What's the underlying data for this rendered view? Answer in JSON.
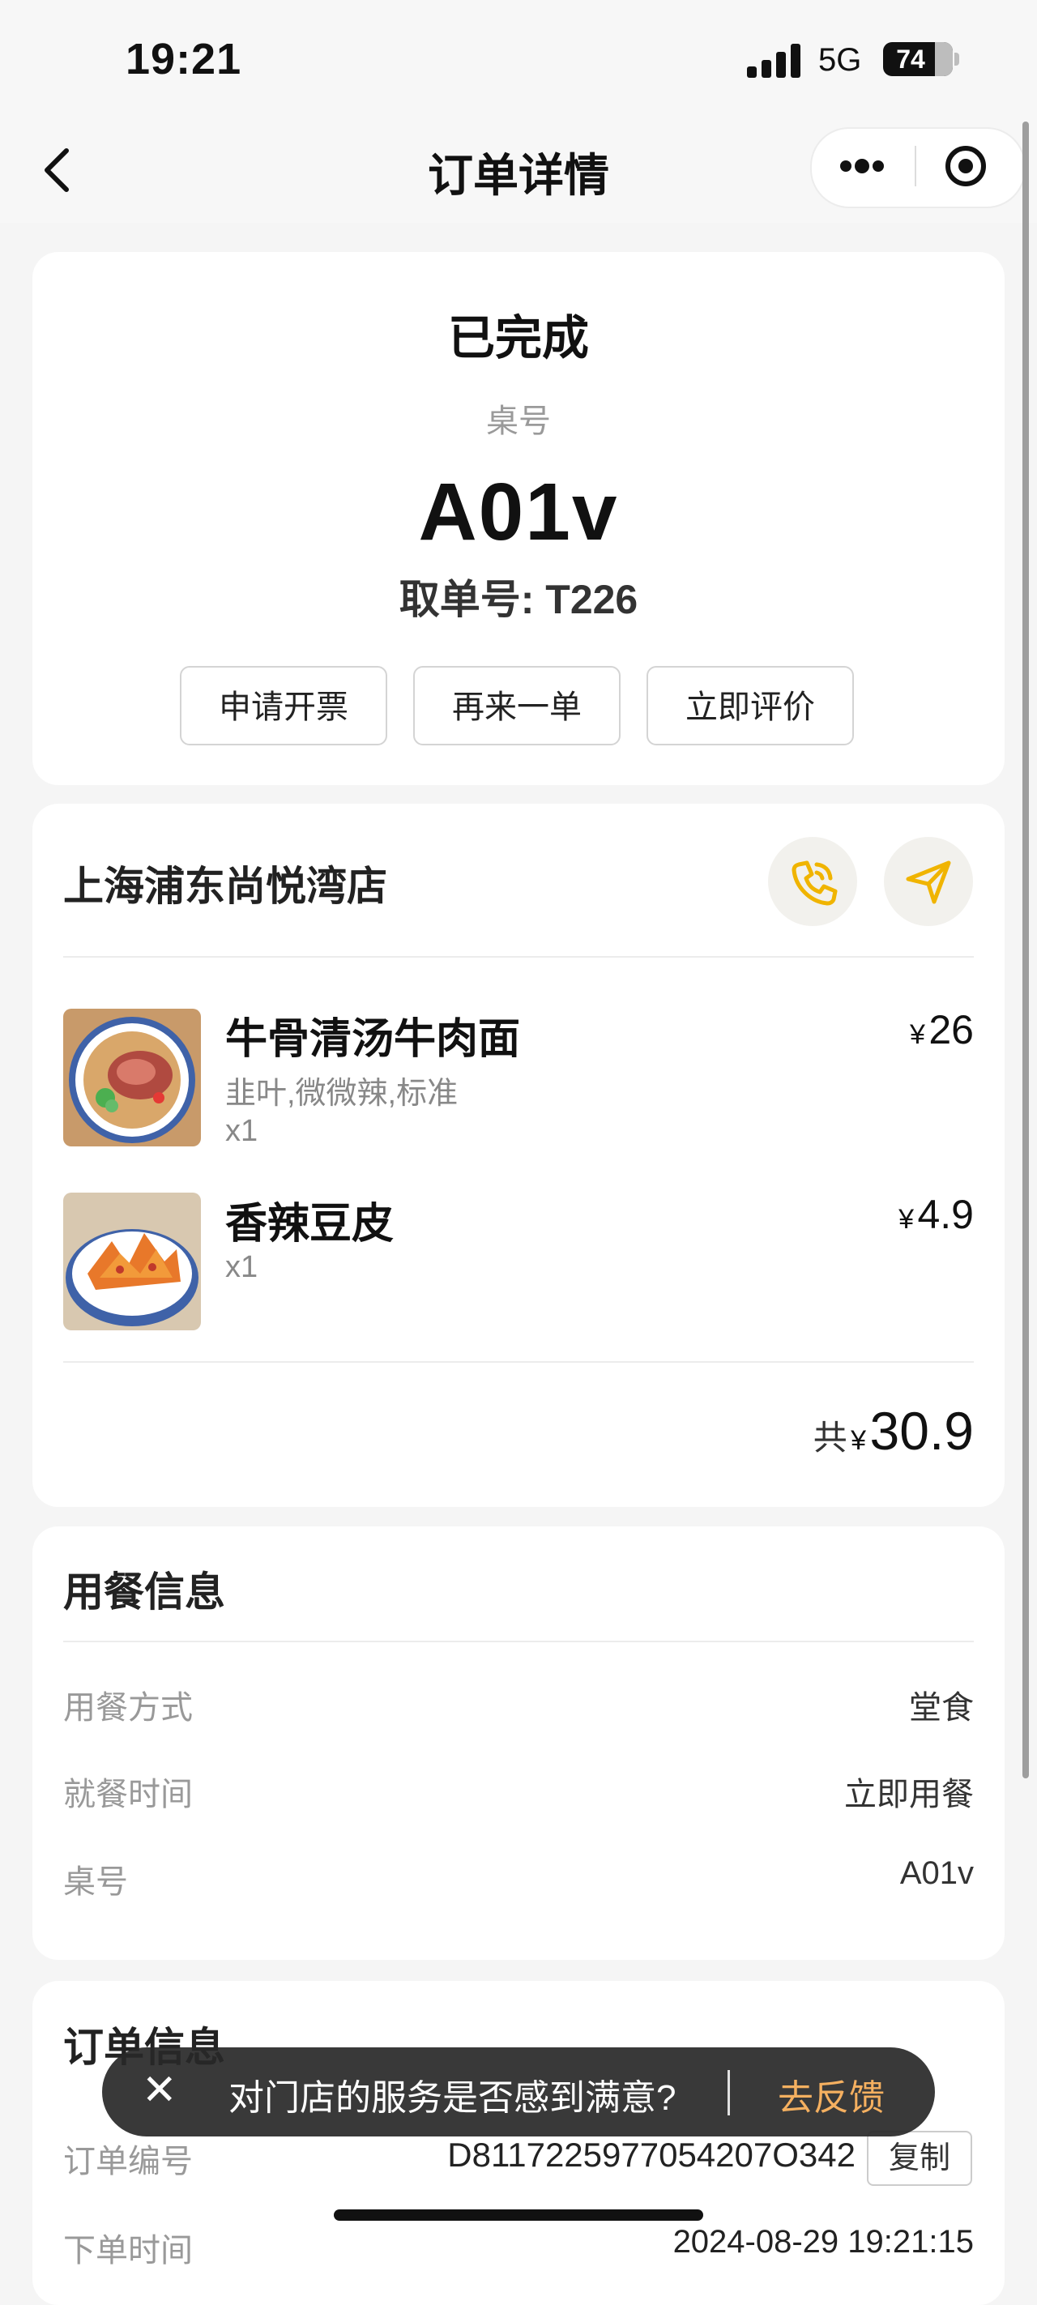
{
  "status_bar": {
    "time": "19:21",
    "network": "5G",
    "battery": "74"
  },
  "nav": {
    "title": "订单详情"
  },
  "order_status": {
    "status": "已完成",
    "table_label": "桌号",
    "table_number": "A01v",
    "pickup": "取单号: T226",
    "buttons": [
      "申请开票",
      "再来一单",
      "立即评价"
    ]
  },
  "store": {
    "name": "上海浦东尚悦湾店",
    "icons": [
      "phone-icon",
      "navigate-icon"
    ],
    "accent_color": "#f0c419",
    "items": [
      {
        "name": "牛骨清汤牛肉面",
        "spec": "韭叶,微微辣,标准",
        "qty": "x1",
        "currency": "¥",
        "price": "26"
      },
      {
        "name": "香辣豆皮",
        "qty": "x1",
        "currency": "¥",
        "price": "4.9"
      }
    ],
    "total_prefix": "共",
    "total_currency": "¥",
    "total": "30.9"
  },
  "dining_info": {
    "title": "用餐信息",
    "rows": [
      {
        "label": "用餐方式",
        "value": "堂食"
      },
      {
        "label": "就餐时间",
        "value": "立即用餐"
      },
      {
        "label": "桌号",
        "value": "A01v"
      }
    ]
  },
  "order_info": {
    "title": "订单信息",
    "order_no_label": "订单编号",
    "order_no": "D8117225977054207O342",
    "copy": "复制",
    "next_label": "下单时间",
    "next_value": "2024-08-29 19:21:15"
  },
  "toast": {
    "text": "对门店的服务是否感到满意?",
    "action": "去反馈",
    "action_color": "#f5b060"
  }
}
